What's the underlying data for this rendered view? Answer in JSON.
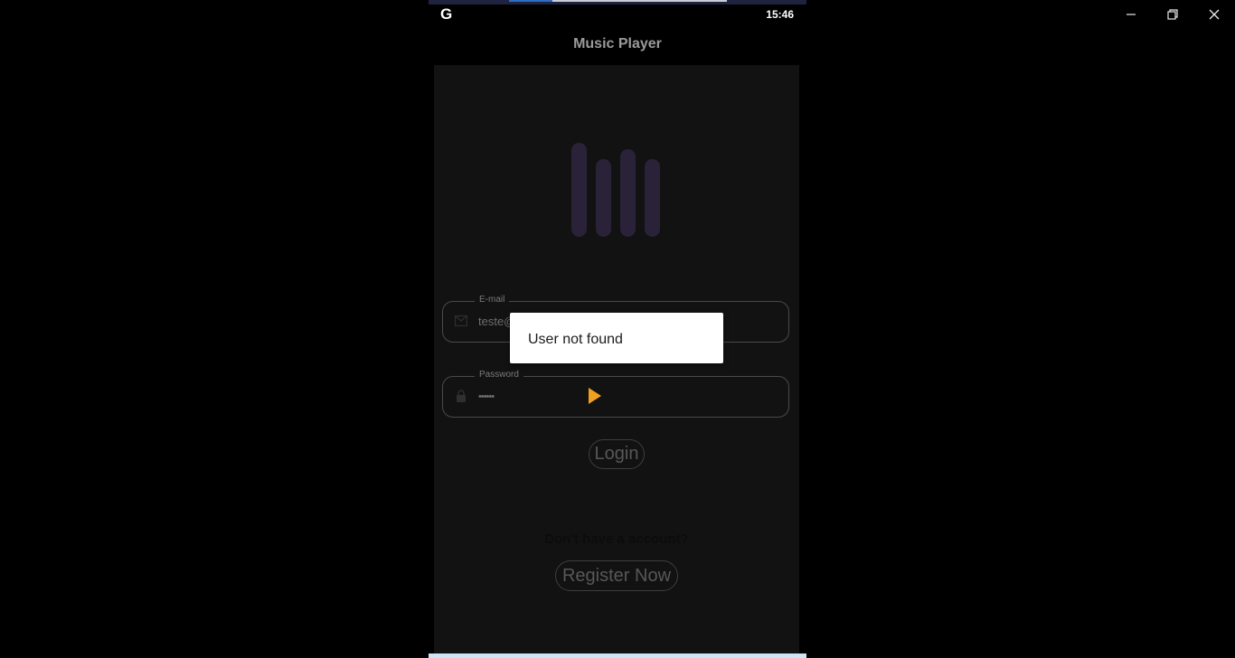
{
  "status_bar": {
    "app_icon": "G",
    "time": "15:46"
  },
  "window_controls": {
    "minimize_icon": "minimize-icon",
    "restore_icon": "restore-icon",
    "close_icon": "close-icon"
  },
  "app": {
    "title": "Music Player",
    "logo_icon": "equalizer-bars-icon",
    "email": {
      "label": "E-mail",
      "value": "teste@",
      "icon": "mail-icon"
    },
    "password": {
      "label": "Password",
      "value": "••••••",
      "icon": "lock-icon"
    },
    "login_label": "Login",
    "no_account_text": "Don't have a account?",
    "register_label": "Register Now"
  },
  "toast": {
    "message": "User not found"
  },
  "colors": {
    "background": "#121212",
    "logo_bar": "#2a2239",
    "toast_bg": "#ffffff",
    "cursor": "#f0a020"
  }
}
